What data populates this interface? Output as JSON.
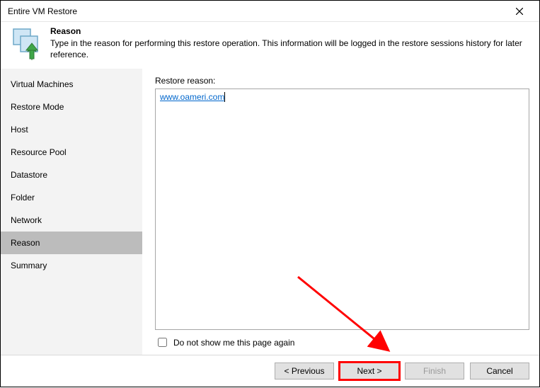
{
  "window": {
    "title": "Entire VM Restore"
  },
  "header": {
    "title": "Reason",
    "description": "Type in the reason for performing this restore operation. This information will be logged in the restore sessions history for later reference."
  },
  "sidebar": {
    "items": [
      {
        "label": "Virtual Machines",
        "selected": false
      },
      {
        "label": "Restore Mode",
        "selected": false
      },
      {
        "label": "Host",
        "selected": false
      },
      {
        "label": "Resource Pool",
        "selected": false
      },
      {
        "label": "Datastore",
        "selected": false
      },
      {
        "label": "Folder",
        "selected": false
      },
      {
        "label": "Network",
        "selected": false
      },
      {
        "label": "Reason",
        "selected": true
      },
      {
        "label": "Summary",
        "selected": false
      }
    ]
  },
  "main": {
    "reason_label": "Restore reason:",
    "reason_value": "www.oameri.com",
    "checkbox_label": "Do not show me this page again",
    "checkbox_checked": false
  },
  "footer": {
    "previous": "< Previous",
    "next": "Next >",
    "finish": "Finish",
    "cancel": "Cancel"
  },
  "annotation": {
    "arrow_color": "#ff0000"
  }
}
